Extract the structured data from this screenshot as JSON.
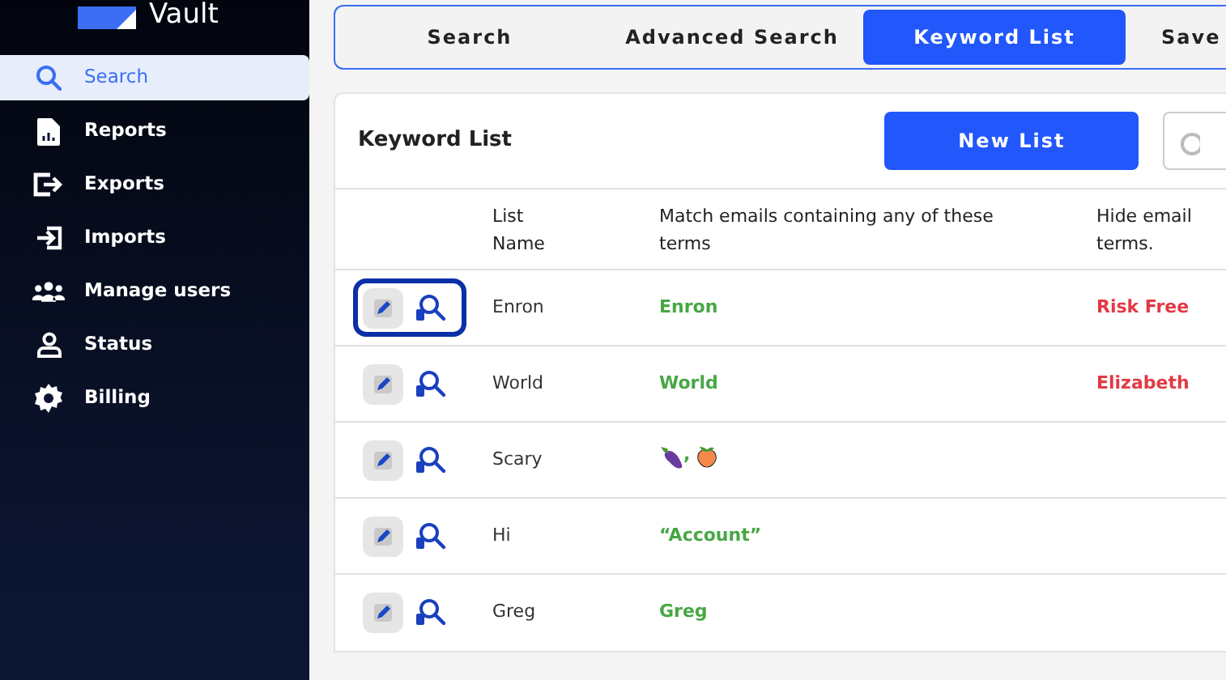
{
  "sidebar": {
    "brand": "Vault",
    "items": [
      {
        "label": "Search",
        "selected": true
      },
      {
        "label": "Reports",
        "selected": false
      },
      {
        "label": "Exports",
        "selected": false
      },
      {
        "label": "Imports",
        "selected": false
      },
      {
        "label": "Manage users",
        "selected": false
      },
      {
        "label": "Status",
        "selected": false
      },
      {
        "label": "Billing",
        "selected": false
      }
    ]
  },
  "tabs": [
    {
      "label": "Search",
      "selected": false
    },
    {
      "label": "Advanced Search",
      "selected": false
    },
    {
      "label": "Keyword List",
      "selected": true
    },
    {
      "label": "Save",
      "selected": false
    }
  ],
  "card": {
    "title": "Keyword List",
    "new_button": "New List",
    "columns": [
      {
        "lines": [
          "List",
          "Name"
        ]
      },
      {
        "lines": [
          "Match emails containing any of these",
          "terms"
        ]
      },
      {
        "lines": [
          "Hide email",
          "terms."
        ]
      }
    ],
    "rows": [
      {
        "focused": true,
        "name": "Enron",
        "match": {
          "kind": "text",
          "text": "Enron"
        },
        "hide": "Risk Free"
      },
      {
        "focused": false,
        "name": "World",
        "match": {
          "kind": "text",
          "text": "World"
        },
        "hide": "Elizabeth"
      },
      {
        "focused": false,
        "name": "Scary",
        "match": {
          "kind": "emoji",
          "separator": ","
        }
      },
      {
        "focused": false,
        "name": "Hi",
        "match": {
          "kind": "text",
          "text": "“Account”"
        }
      },
      {
        "focused": false,
        "name": "Greg",
        "match": {
          "kind": "text",
          "text": "Greg"
        }
      }
    ]
  }
}
